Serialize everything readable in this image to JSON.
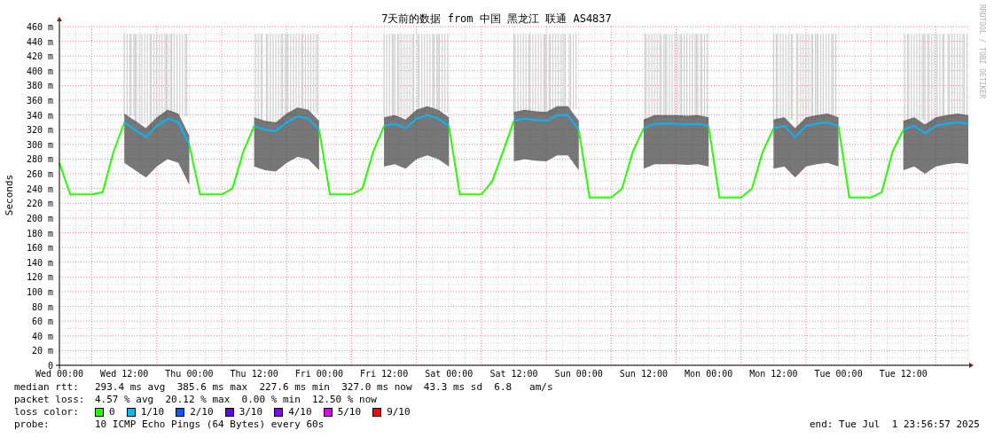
{
  "chart": {
    "chart_data": {
      "type": "line",
      "title": "7天前的数据 from 中国 黑龙江 联通 AS4837",
      "ylabel": "Seconds",
      "categories": [
        "Wed 00:00",
        null,
        null,
        null,
        null,
        null,
        "Wed 12:00",
        null,
        null,
        null,
        null,
        null,
        "Thu 00:00",
        null,
        null,
        null,
        null,
        null,
        "Thu 12:00",
        null,
        null,
        null,
        null,
        null,
        "Fri 00:00",
        null,
        null,
        null,
        null,
        null,
        "Fri 12:00",
        null,
        null,
        null,
        null,
        null,
        "Sat 00:00",
        null,
        null,
        null,
        null,
        null,
        "Sat 12:00",
        null,
        null,
        null,
        null,
        null,
        "Sun 00:00",
        null,
        null,
        null,
        null,
        null,
        "Sun 12:00",
        null,
        null,
        null,
        null,
        null,
        "Mon 00:00",
        null,
        null,
        null,
        null,
        null,
        "Mon 12:00",
        null,
        null,
        null,
        null,
        null,
        "Tue 00:00",
        null,
        null,
        null,
        null,
        null,
        "Tue 12:00",
        null,
        null,
        null,
        null,
        null,
        null
      ],
      "series": [
        {
          "color": "#26ff00",
          "values": [
            275,
            232,
            232,
            232,
            235,
            290,
            330,
            null,
            null,
            null,
            null,
            null,
            300,
            232,
            232,
            232,
            240,
            290,
            325,
            null,
            null,
            null,
            null,
            null,
            320,
            232,
            232,
            232,
            240,
            290,
            325,
            null,
            null,
            null,
            null,
            null,
            325,
            232,
            232,
            232,
            250,
            290,
            332,
            null,
            null,
            null,
            null,
            null,
            320,
            228,
            228,
            228,
            240,
            290,
            322,
            null,
            null,
            null,
            null,
            null,
            325,
            228,
            228,
            228,
            240,
            290,
            322,
            null,
            null,
            null,
            null,
            null,
            325,
            228,
            228,
            228,
            235,
            290,
            320,
            null,
            null,
            null,
            null,
            null,
            null
          ]
        },
        {
          "color": "#00b8ff",
          "values": [
            null,
            null,
            null,
            null,
            null,
            null,
            330,
            320,
            310,
            325,
            335,
            330,
            300,
            null,
            null,
            null,
            null,
            null,
            325,
            320,
            318,
            330,
            338,
            335,
            320,
            null,
            null,
            null,
            null,
            null,
            325,
            328,
            322,
            335,
            340,
            335,
            325,
            null,
            null,
            null,
            null,
            null,
            332,
            335,
            333,
            332,
            340,
            340,
            320,
            null,
            null,
            null,
            null,
            null,
            322,
            328,
            328,
            328,
            327,
            328,
            325,
            null,
            null,
            null,
            null,
            null,
            322,
            325,
            310,
            325,
            328,
            330,
            325,
            null,
            null,
            null,
            null,
            null,
            320,
            325,
            315,
            325,
            328,
            330,
            328
          ]
        }
      ],
      "ylim": [
        0,
        460
      ],
      "grid": true,
      "yticks": [
        {
          "value": 0,
          "label": "0"
        },
        {
          "value": 20,
          "label": "20 m"
        },
        {
          "value": 40,
          "label": "40 m"
        },
        {
          "value": 60,
          "label": "60 m"
        },
        {
          "value": 80,
          "label": "80 m"
        },
        {
          "value": 100,
          "label": "100 m"
        },
        {
          "value": 120,
          "label": "120 m"
        },
        {
          "value": 140,
          "label": "140 m"
        },
        {
          "value": 160,
          "label": "160 m"
        },
        {
          "value": 180,
          "label": "180 m"
        },
        {
          "value": 200,
          "label": "200 m"
        },
        {
          "value": 220,
          "label": "220 m"
        },
        {
          "value": 240,
          "label": "240 m"
        },
        {
          "value": 260,
          "label": "260 m"
        },
        {
          "value": 280,
          "label": "280 m"
        },
        {
          "value": 300,
          "label": "300 m"
        },
        {
          "value": 320,
          "label": "320 m"
        },
        {
          "value": 340,
          "label": "340 m"
        },
        {
          "value": 360,
          "label": "360 m"
        },
        {
          "value": 380,
          "label": "380 m"
        },
        {
          "value": 400,
          "label": "400 m"
        },
        {
          "value": 420,
          "label": "420 m"
        },
        {
          "value": 440,
          "label": "440 m"
        },
        {
          "value": 460,
          "label": "460 m"
        }
      ]
    },
    "credit": "RRDTOOL / TOBI OETIKER"
  },
  "legend": {
    "median_rtt": {
      "label": "median rtt:",
      "text": "293.4 ms avg  385.6 ms max  227.6 ms min  327.0 ms now  43.3 ms sd  6.8   am/s"
    },
    "packet_loss": {
      "label": "packet loss:",
      "text": "4.57 % avg  20.12 % max  0.00 % min  12.50 % now"
    },
    "loss_color": {
      "label": "loss color:",
      "items": [
        {
          "label": "0",
          "color": "#26ff00"
        },
        {
          "label": "1/10",
          "color": "#00b8ff"
        },
        {
          "label": "2/10",
          "color": "#0059ff"
        },
        {
          "label": "3/10",
          "color": "#5e00ff"
        },
        {
          "label": "4/10",
          "color": "#7e00ff"
        },
        {
          "label": "5/10",
          "color": "#dd00ff"
        },
        {
          "label": "9/10",
          "color": "#ff0000"
        }
      ]
    },
    "probe": {
      "label": "probe:",
      "text": "10 ICMP Echo Pings (64 Bytes) every 60s"
    },
    "end": "end: Tue Jul  1 23:56:57 2025"
  }
}
